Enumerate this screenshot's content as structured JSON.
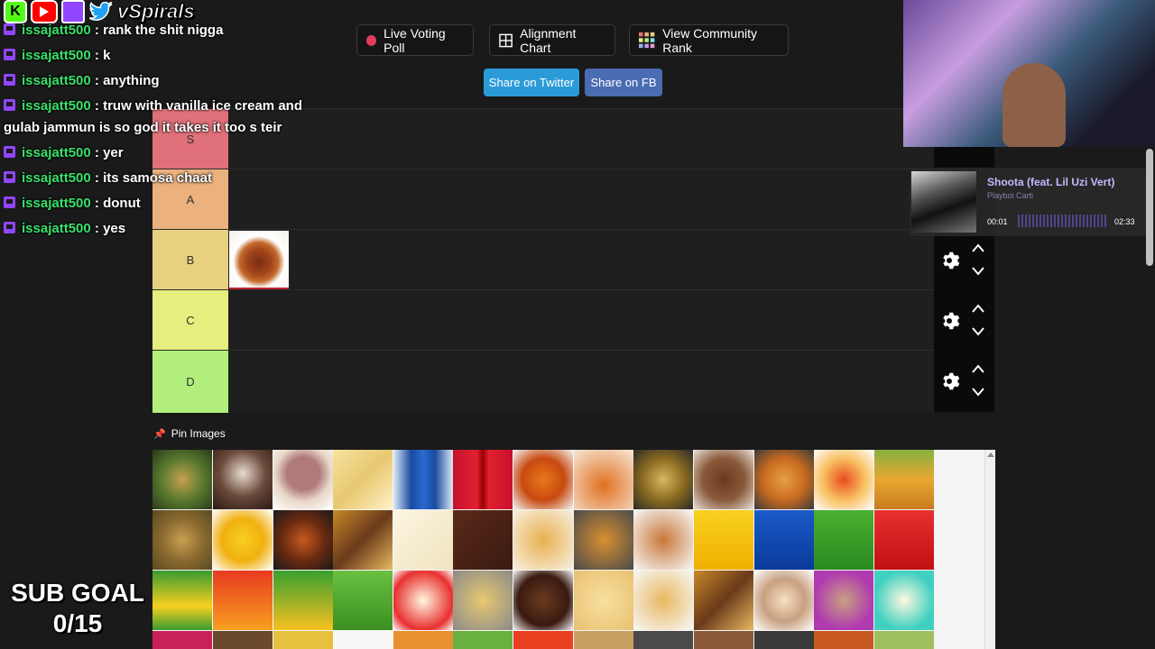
{
  "overlay": {
    "brand_text": "vSpirals",
    "sub_goal_label": "SUB GOAL",
    "sub_goal_value": "0/15"
  },
  "toolbar": {
    "live_voting_label": "Live Voting Poll",
    "alignment_label": "Alignment Chart",
    "community_rank_label": "View Community Rank",
    "share_twitter_label": "Share on Twitter",
    "share_fb_label": "Share on FB"
  },
  "tiers": [
    {
      "label": "S",
      "color": "#e0707a"
    },
    {
      "label": "A",
      "color": "#ebb17e"
    },
    {
      "label": "B",
      "color": "#e7d180"
    },
    {
      "label": "C",
      "color": "#e6ee7f"
    },
    {
      "label": "D",
      "color": "#b2ee7c"
    }
  ],
  "chat": [
    {
      "user": "issajatt500",
      "msg": "rank the shit nigga"
    },
    {
      "user": "issajatt500",
      "msg": "k"
    },
    {
      "user": "issajatt500",
      "msg": "anything"
    },
    {
      "user": "issajatt500",
      "msg": "truw with vanilla ice cream and",
      "wrap": "gulab jammun is so god it takes it too s teir"
    },
    {
      "user": "issajatt500",
      "msg": "yer"
    },
    {
      "user": "issajatt500",
      "msg": "its samosa chaat"
    },
    {
      "user": "issajatt500",
      "msg": "donut"
    },
    {
      "user": "issajatt500",
      "msg": "yes"
    }
  ],
  "pin": {
    "label": "Pin Images"
  },
  "music": {
    "title": "Shoota (feat. Lil Uzi Vert)",
    "artist": "Playboi Carti",
    "elapsed": "00:01",
    "duration": "02:33"
  },
  "colors": {
    "twitter": "#2b9bd8",
    "facebook": "#4a6cb3",
    "chat_user": "#38e06a",
    "accent_purple": "#9146ff"
  }
}
